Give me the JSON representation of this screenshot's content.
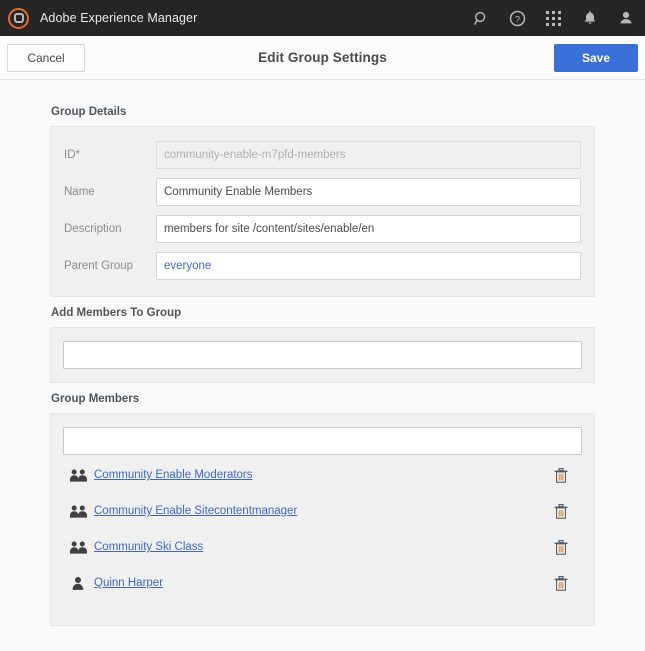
{
  "header": {
    "brand": "Adobe Experience Manager",
    "icons": [
      {
        "name": "search-icon"
      },
      {
        "name": "help-icon"
      },
      {
        "name": "apps-grid-icon"
      },
      {
        "name": "bell-icon"
      },
      {
        "name": "user-avatar-icon"
      }
    ]
  },
  "toolbar": {
    "cancel_label": "Cancel",
    "title": "Edit Group Settings",
    "save_label": "Save",
    "save_color": "#3a6fd8"
  },
  "group_details": {
    "section_title": "Group Details",
    "fields": [
      {
        "label": "ID*",
        "value": "community-enable-m7pfd-members",
        "disabled": true,
        "is_link": false
      },
      {
        "label": "Name",
        "value": "Community Enable Members",
        "disabled": false,
        "is_link": false
      },
      {
        "label": "Description",
        "value": "members for site /content/sites/enable/en",
        "disabled": false,
        "is_link": false
      },
      {
        "label": "Parent Group",
        "value": "everyone",
        "disabled": false,
        "is_link": true
      }
    ]
  },
  "add_members": {
    "section_title": "Add Members To Group",
    "input_value": "",
    "input_placeholder": ""
  },
  "group_members": {
    "section_title": "Group Members",
    "filter_value": "",
    "filter_placeholder": "",
    "delete_icon": "trash-icon",
    "items": [
      {
        "name": "Community Enable Moderators",
        "type": "group"
      },
      {
        "name": "Community Enable Sitecontentmanager",
        "type": "group"
      },
      {
        "name": "Community Ski Class",
        "type": "group"
      },
      {
        "name": "Quinn Harper",
        "type": "user"
      }
    ]
  }
}
